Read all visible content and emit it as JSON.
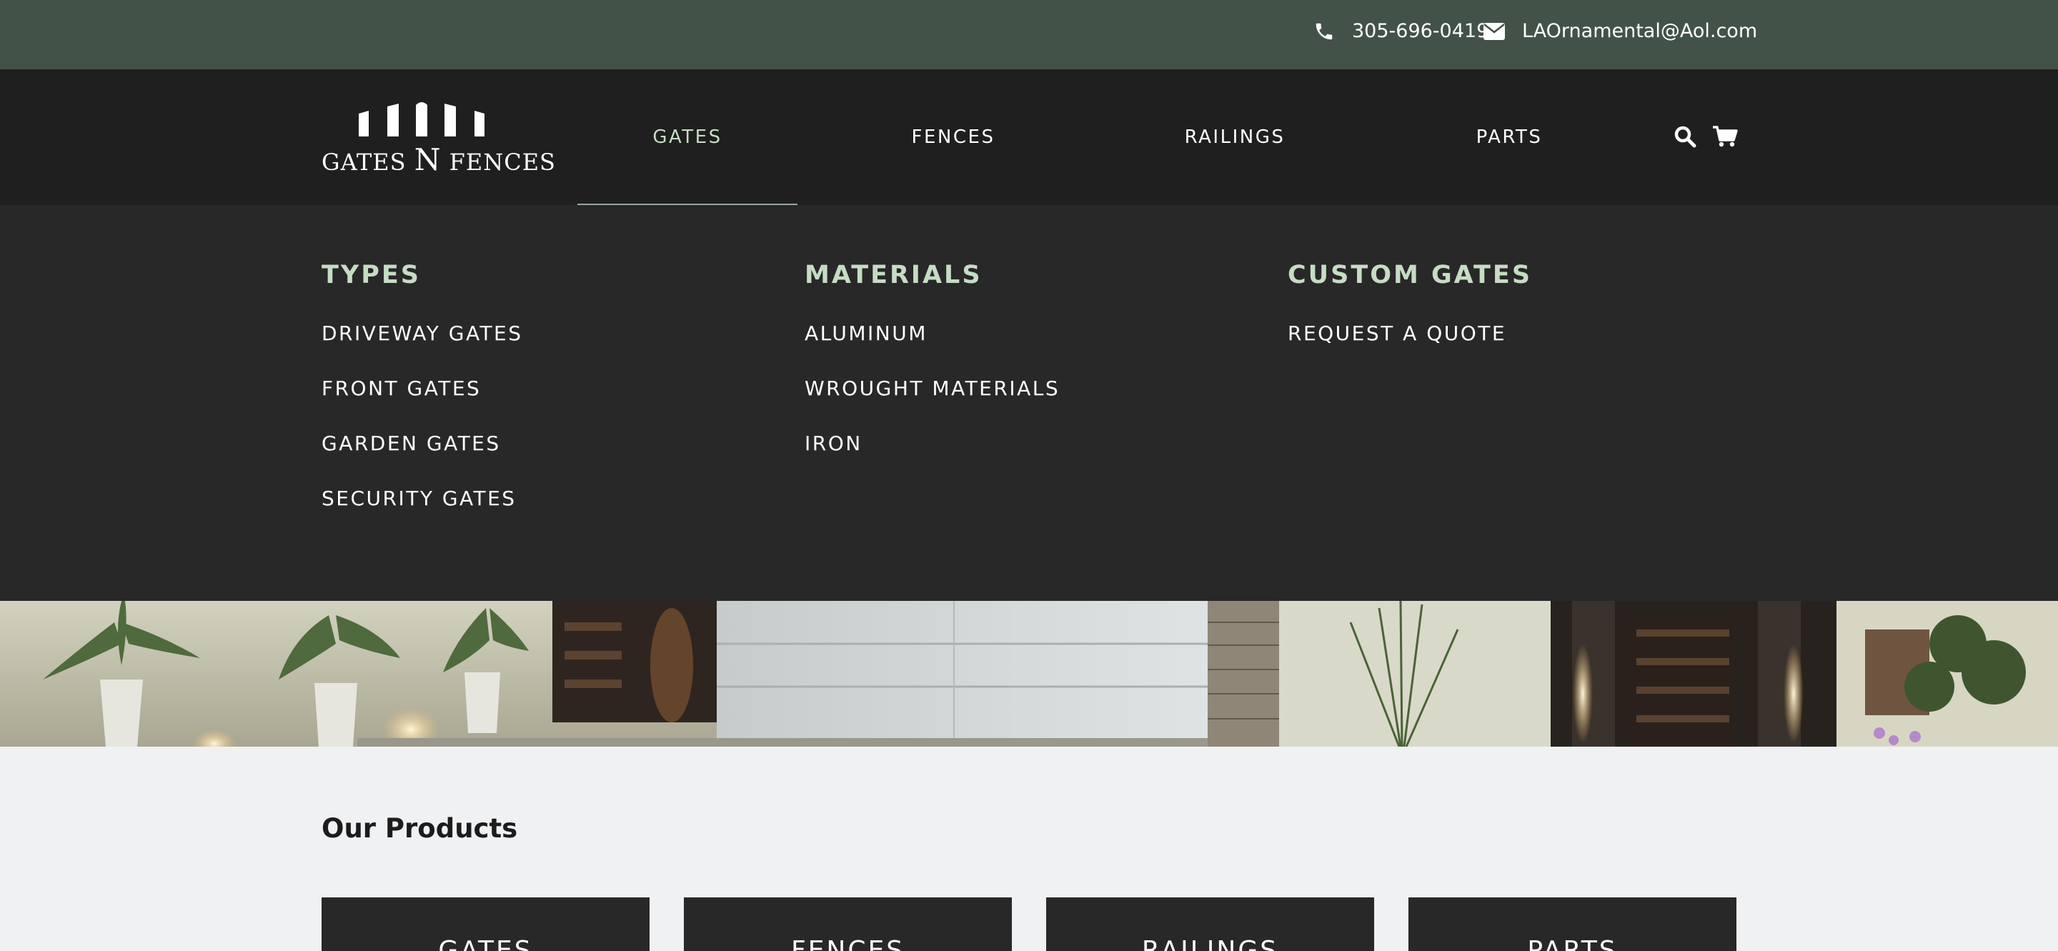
{
  "contact": {
    "phone": "305-696-0419",
    "email": "LAOrnamental@Aol.com"
  },
  "logo": {
    "part1": "GATES ",
    "part2": "N",
    "part3": " FENCES"
  },
  "nav": {
    "gates": "GATES",
    "fences": "FENCES",
    "railings": "RAILINGS",
    "parts": "PARTS"
  },
  "mega_menu": {
    "types": {
      "heading": "TYPES",
      "items": [
        "DRIVEWAY GATES",
        "FRONT GATES",
        "GARDEN GATES",
        "SECURITY GATES"
      ]
    },
    "materials": {
      "heading": "MATERIALS",
      "items": [
        "ALUMINUM",
        "WROUGHT MATERIALS",
        "IRON"
      ]
    },
    "custom": {
      "heading": "CUSTOM GATES",
      "items": [
        "REQUEST A QUOTE"
      ]
    }
  },
  "products": {
    "title": "Our Products",
    "cards": [
      "GATES",
      "FENCES",
      "RAILINGS",
      "PARTS"
    ]
  },
  "icons": {
    "phone": "phone-icon",
    "email": "envelope-icon",
    "search": "search-icon",
    "cart": "cart-icon"
  },
  "colors": {
    "topbar": "#435249",
    "navbar": "#1f1f1f",
    "dropdown": "#282828",
    "accent": "#c6dcc4",
    "page_bg": "#f0f1f3"
  }
}
